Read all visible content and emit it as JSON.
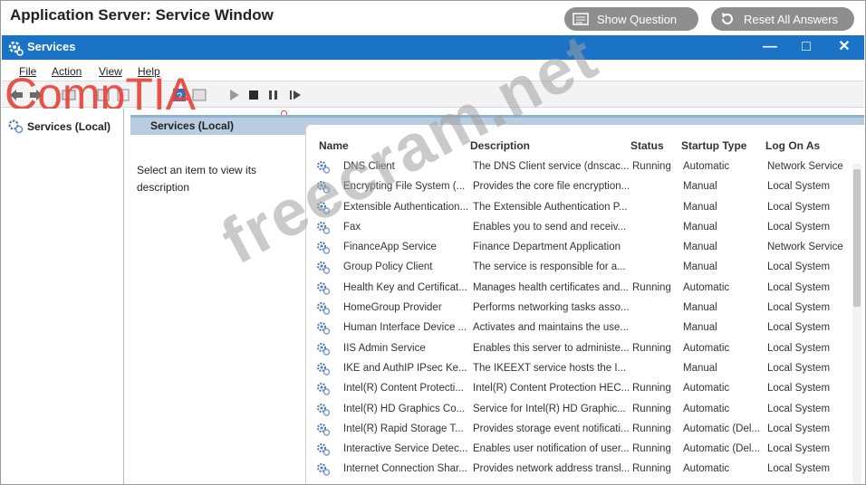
{
  "app": {
    "title": "Application Server: Service Window",
    "show_question": "Show Question",
    "reset_answers": "Reset All Answers"
  },
  "window": {
    "title": "Services",
    "minimize": "—",
    "maximize": "□",
    "close": "✕"
  },
  "menu": [
    "File",
    "Action",
    "View",
    "Help"
  ],
  "brand": "CompTIA",
  "watermark": "freecram.net",
  "left_pane": {
    "label": "Services (Local)"
  },
  "right_pane": {
    "header": "Services (Local)",
    "description_text": "Select an item to view its description"
  },
  "columns": {
    "name": "Name",
    "description": "Description",
    "status": "Status",
    "startup_type": "Startup Type",
    "log_on_as": "Log On As"
  },
  "services": [
    {
      "name": "DNS Client",
      "description": "The DNS Client service (dnscac...",
      "status": "Running",
      "startup": "Automatic",
      "logon": "Network Service"
    },
    {
      "name": "Encrypting File System (...",
      "description": "Provides the core file encryption...",
      "status": "",
      "startup": "Manual",
      "logon": "Local System"
    },
    {
      "name": "Extensible Authentication...",
      "description": "The Extensible Authentication P...",
      "status": "",
      "startup": "Manual",
      "logon": "Local System"
    },
    {
      "name": "Fax",
      "description": "Enables you to send and receiv...",
      "status": "",
      "startup": "Manual",
      "logon": "Local System"
    },
    {
      "name": "FinanceApp Service",
      "description": "Finance Department Application",
      "status": "",
      "startup": "Manual",
      "logon": "Network Service"
    },
    {
      "name": "Group Policy Client",
      "description": "The service is responsible for a...",
      "status": "",
      "startup": "Manual",
      "logon": "Local System"
    },
    {
      "name": "Health Key and Certificat...",
      "description": "Manages health certificates and...",
      "status": "Running",
      "startup": "Automatic",
      "logon": "Local System"
    },
    {
      "name": "HomeGroup Provider",
      "description": "Performs networking tasks asso...",
      "status": "",
      "startup": "Manual",
      "logon": "Local System"
    },
    {
      "name": "Human Interface Device ...",
      "description": "Activates and maintains the use...",
      "status": "",
      "startup": "Manual",
      "logon": "Local System"
    },
    {
      "name": "IIS Admin Service",
      "description": "Enables this server to administe...",
      "status": "Running",
      "startup": "Automatic",
      "logon": "Local System"
    },
    {
      "name": "IKE and AuthIP IPsec Ke...",
      "description": "The IKEEXT service hosts the I...",
      "status": "",
      "startup": "Manual",
      "logon": "Local System"
    },
    {
      "name": "Intel(R) Content Protecti...",
      "description": "Intel(R) Content Protection HEC...",
      "status": "Running",
      "startup": "Automatic",
      "logon": "Local System"
    },
    {
      "name": "Intel(R) HD Graphics Co...",
      "description": "Service for Intel(R) HD Graphic...",
      "status": "Running",
      "startup": "Automatic",
      "logon": "Local System"
    },
    {
      "name": "Intel(R) Rapid Storage T...",
      "description": "Provides storage event notificati...",
      "status": "Running",
      "startup": "Automatic (Del...",
      "logon": "Local System"
    },
    {
      "name": "Interactive Service Detec...",
      "description": "Enables user notification of user...",
      "status": "Running",
      "startup": "Automatic (Del...",
      "logon": "Local System"
    },
    {
      "name": "Internet Connection Shar...",
      "description": "Provides network address transl...",
      "status": "Running",
      "startup": "Automatic",
      "logon": "Local System"
    }
  ],
  "colors": {
    "accent": "#1a73c6",
    "brand": "#e8453c",
    "header_band": "#b9cde0"
  }
}
